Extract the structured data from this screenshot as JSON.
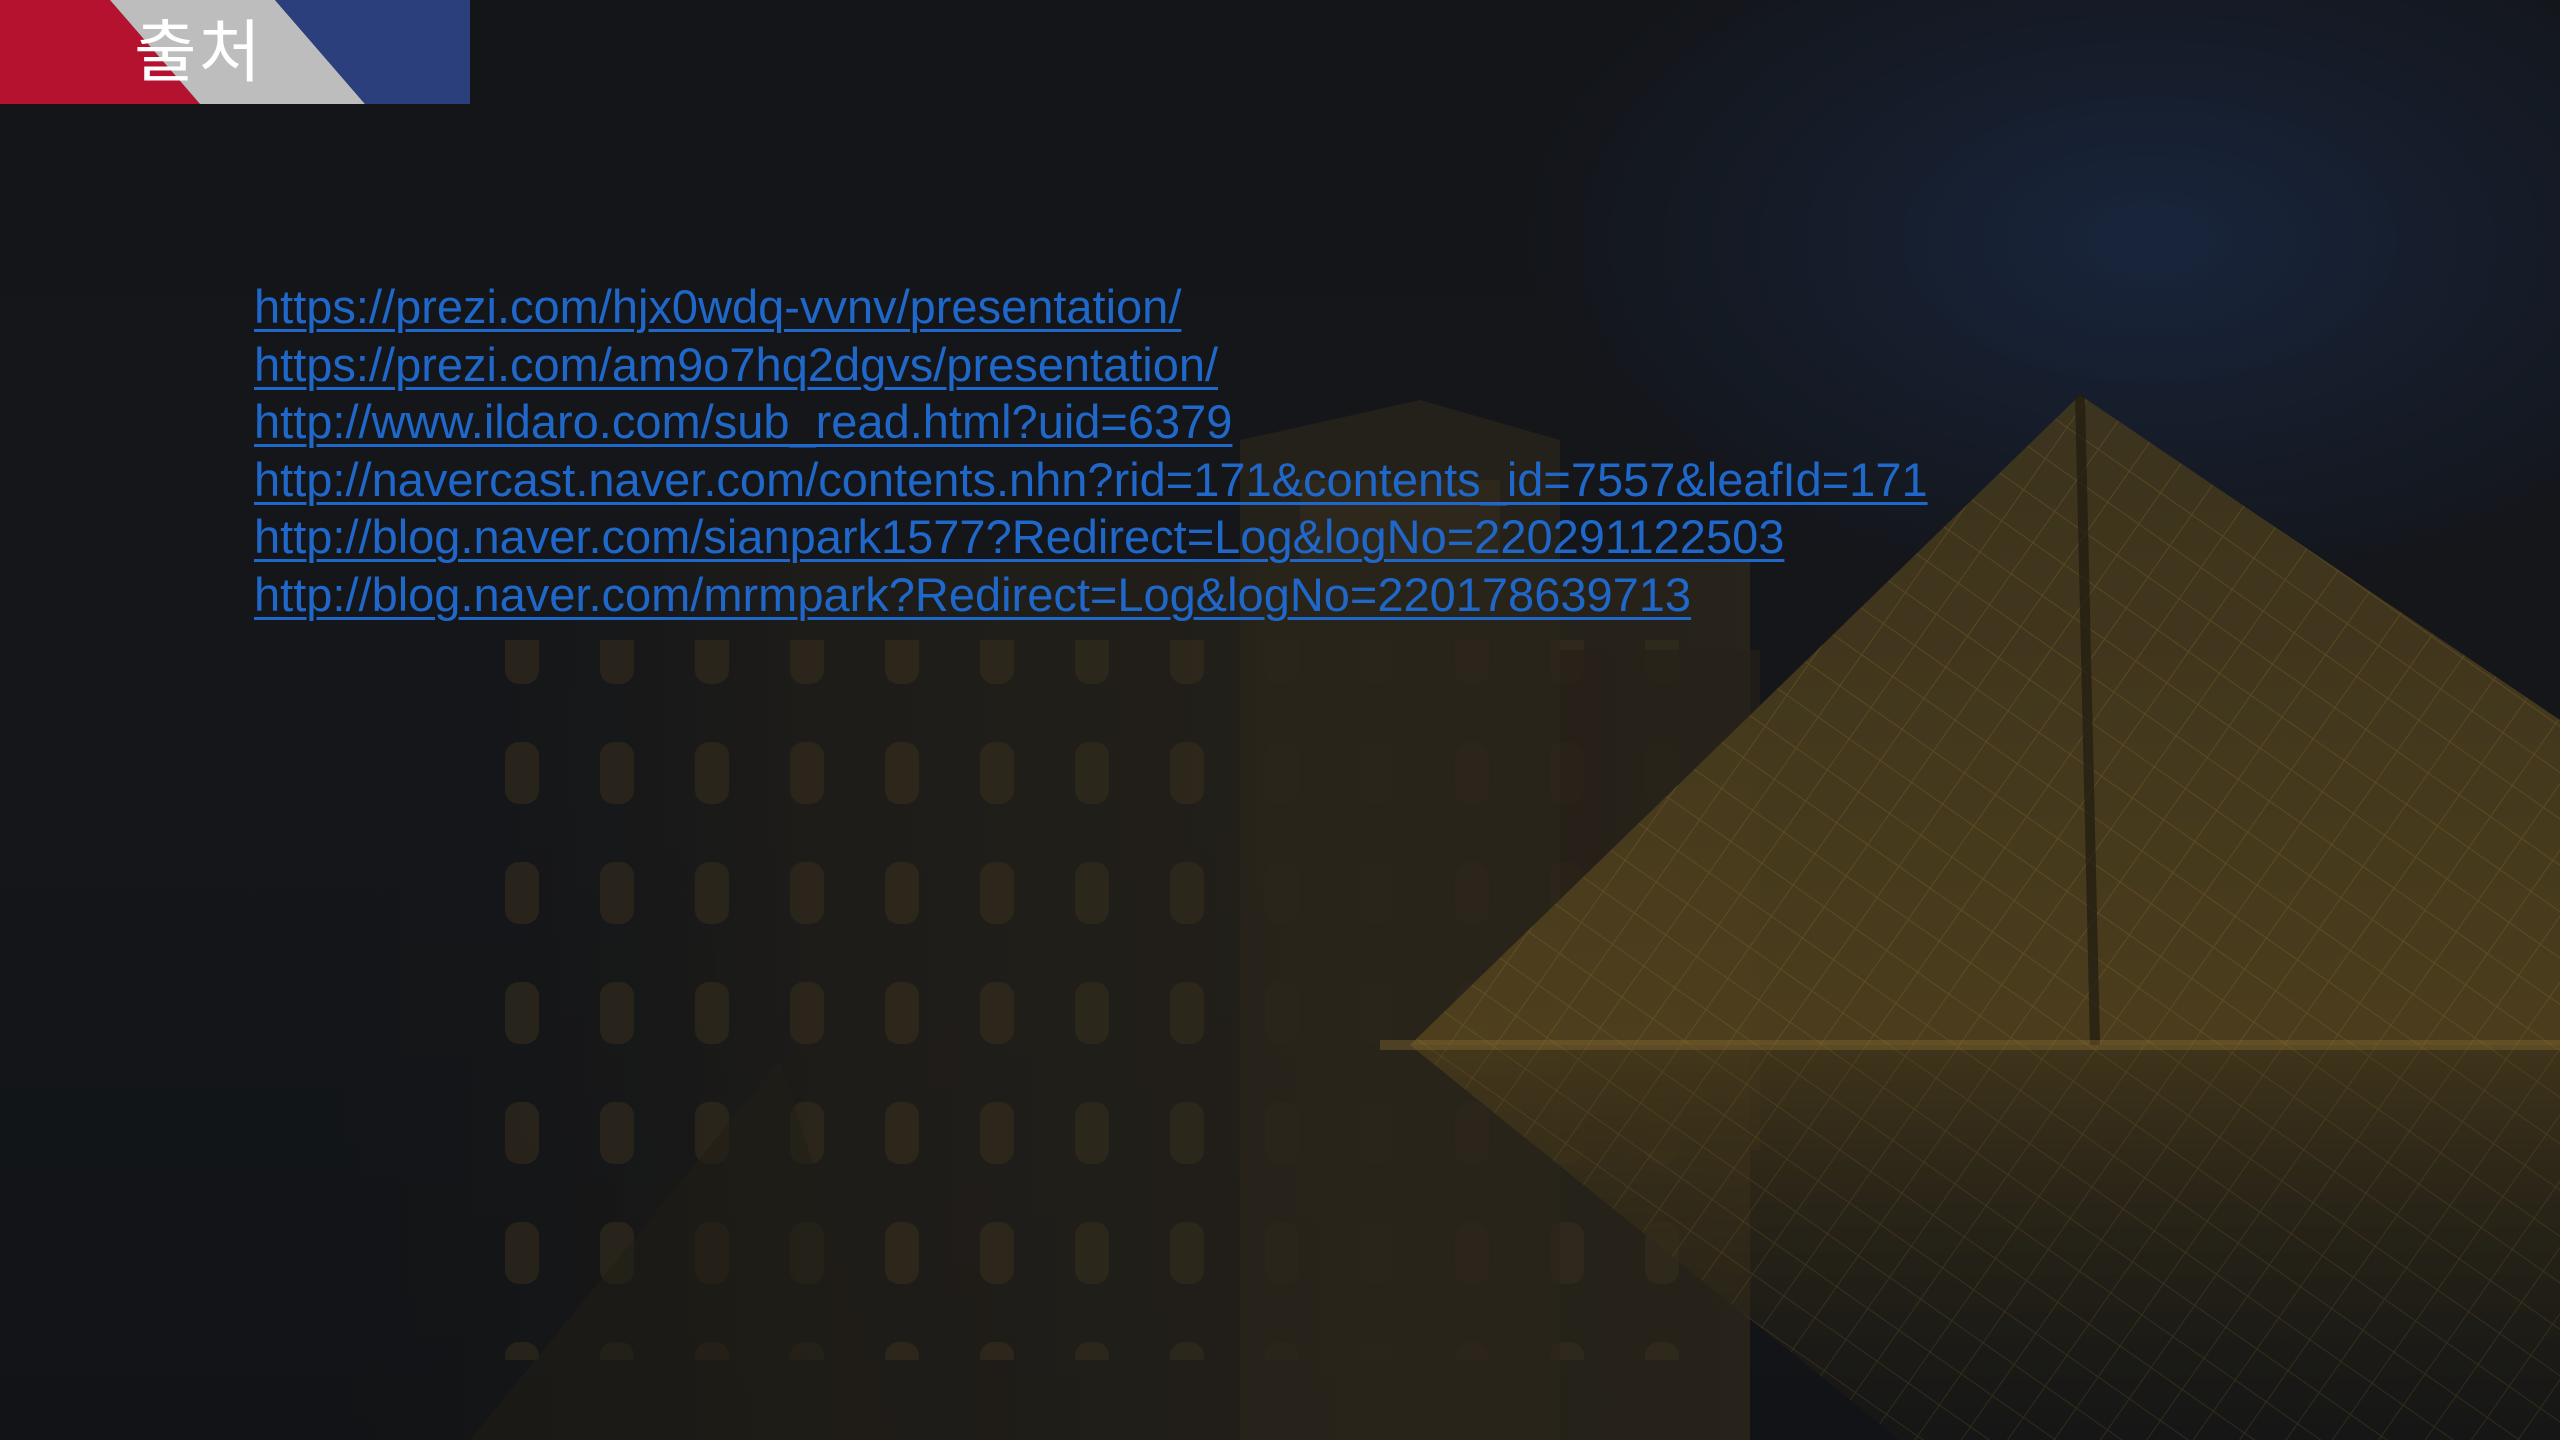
{
  "slide": {
    "title": "출처",
    "links": [
      "https://prezi.com/hjx0wdq-vvnv/presentation/",
      "https://prezi.com/am9o7hq2dgvs/presentation/",
      "http://www.ildaro.com/sub_read.html?uid=6379",
      "http://navercast.naver.com/contents.nhn?rid=171&contents_id=7557&leafId=171",
      "http://blog.naver.com/sianpark1577?Redirect=Log&logNo=220291122503",
      "http://blog.naver.com/mrmpark?Redirect=Log&logNo=220178639713"
    ]
  },
  "colors": {
    "banner_red": "#b5122f",
    "banner_white": "#bdbdbd",
    "banner_blue": "#2b3f7c",
    "link_blue": "#1f67c9",
    "background": "#16181d"
  }
}
